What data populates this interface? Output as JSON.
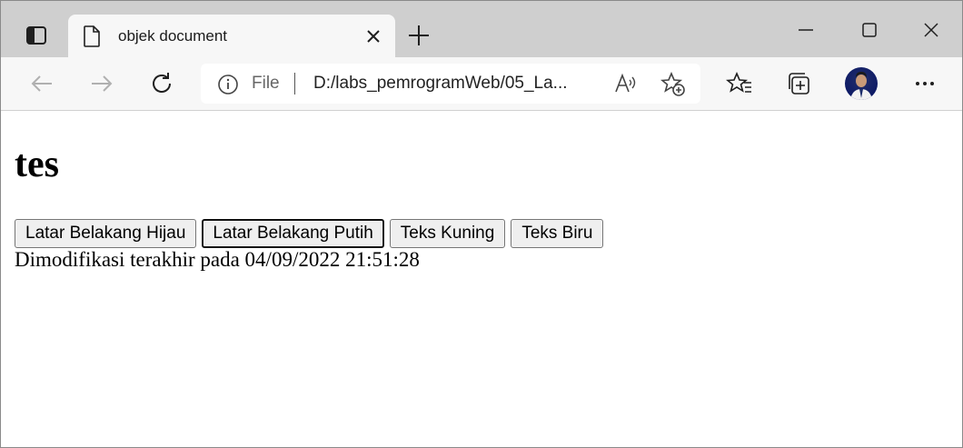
{
  "window": {
    "tab_title": "objek document"
  },
  "toolbar": {
    "address": {
      "scheme_label": "File",
      "url": "D:/labs_pemrogramWeb/05_La..."
    }
  },
  "page": {
    "heading": "tes",
    "buttons": [
      {
        "label": "Latar Belakang Hijau",
        "focused": false
      },
      {
        "label": "Latar Belakang Putih",
        "focused": true
      },
      {
        "label": "Teks Kuning",
        "focused": false
      },
      {
        "label": "Teks Biru",
        "focused": false
      }
    ],
    "modified_text": "Dimodifikasi terakhir pada 04/09/2022 21:51:28"
  },
  "icons": {
    "tab_actions": "tab-actions-icon",
    "page": "page-icon",
    "close_tab": "close-icon",
    "new_tab": "plus-icon",
    "minimize": "minimize-icon",
    "maximize": "maximize-icon",
    "close_window": "close-icon",
    "back": "back-arrow-icon",
    "forward": "forward-arrow-icon",
    "refresh": "refresh-icon",
    "info": "info-icon",
    "read_aloud": "read-aloud-icon",
    "add_favorite": "add-favorite-icon",
    "favorites": "favorites-icon",
    "collections": "collections-icon",
    "profile": "avatar",
    "menu": "more-icon"
  },
  "colors": {
    "titlebar_bg": "#cfcfcf",
    "toolbar_bg": "#f7f7f7",
    "button_bg": "#efefef"
  }
}
